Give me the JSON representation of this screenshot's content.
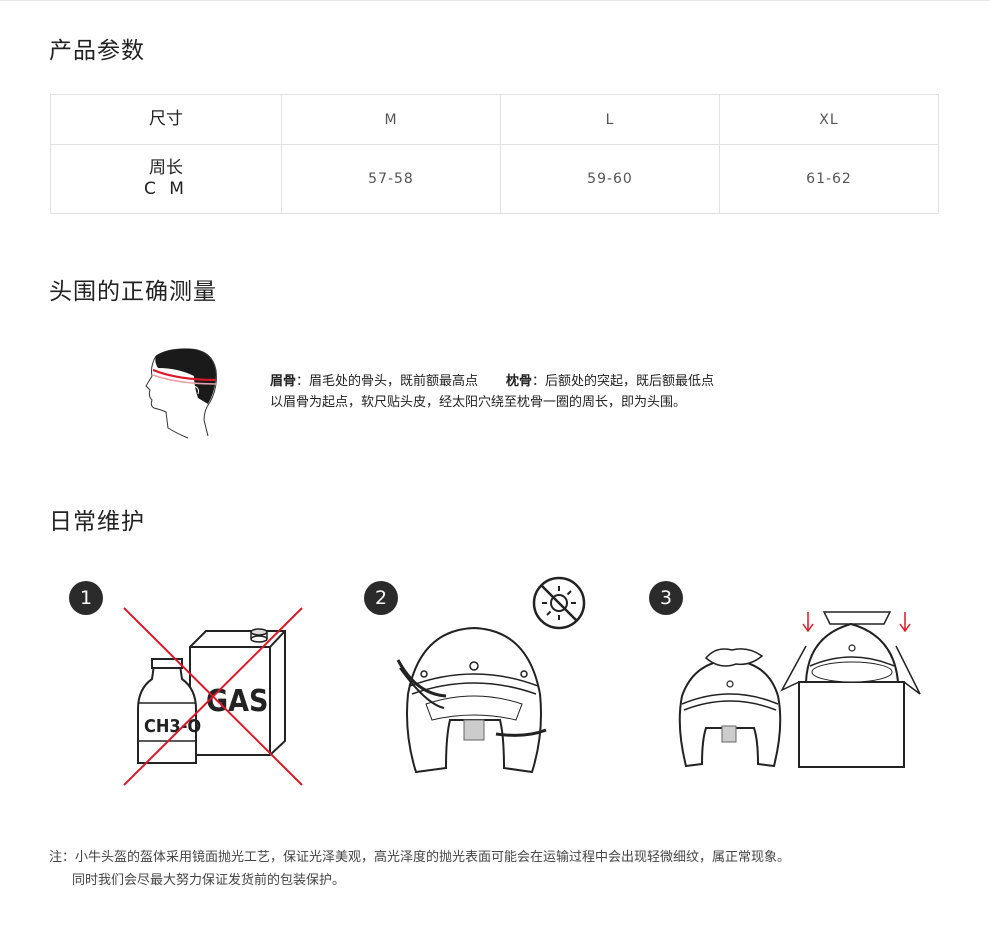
{
  "sections": {
    "params_title": "产品参数",
    "measure_title": "头围的正确测量",
    "care_title": "日常维护"
  },
  "size_table": {
    "header": {
      "label": "尺寸",
      "sizes": [
        "M",
        "L",
        "XL"
      ]
    },
    "row": {
      "label_line1": "周长",
      "label_line2": "C M",
      "values": [
        "57-58",
        "59-60",
        "61-62"
      ]
    }
  },
  "measure": {
    "brow_term": "眉骨",
    "brow_desc": "：眉毛处的骨头，既前额最高点",
    "occiput_term": "枕骨",
    "occiput_desc": "：后额处的突起，既后额最低点",
    "line2": "以眉骨为起点，软尺贴头皮，经太阳穴绕至枕骨一圈的周长，即为头围。"
  },
  "care_steps": [
    {
      "number": "1",
      "bottle_label": "CH3-O",
      "can_label": "GAS"
    },
    {
      "number": "2",
      "icon": "no-sun-icon"
    },
    {
      "number": "3",
      "icon": "down-arrow-icon"
    }
  ],
  "note": {
    "line1": "注：小牛头盔的盔体采用镜面抛光工艺，保证光泽美观，高光泽度的抛光表面可能会在运输过程中会出现轻微细纹，属正常现象。",
    "line2": "同时我们会尽最大努力保证发货前的包装保护。"
  },
  "colors": {
    "accent_red": "#d9182c",
    "dark": "#2b2b2b"
  }
}
